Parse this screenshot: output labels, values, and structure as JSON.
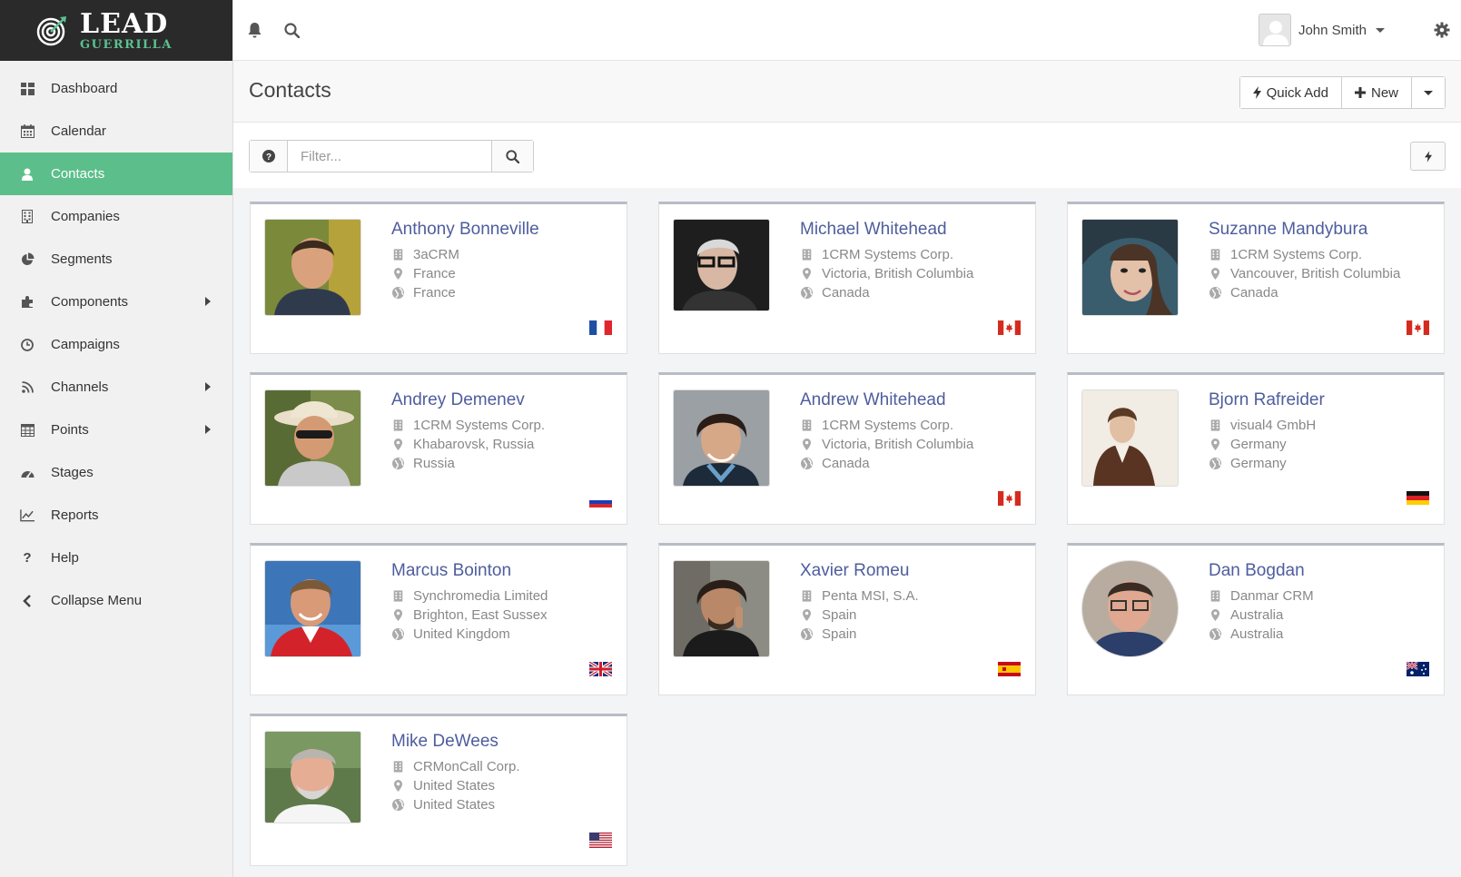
{
  "brand": {
    "main": "LEAD",
    "sub": "GUERRILLA"
  },
  "sidebar": {
    "items": [
      {
        "label": "Dashboard",
        "icon": "grid-icon"
      },
      {
        "label": "Calendar",
        "icon": "calendar-icon"
      },
      {
        "label": "Contacts",
        "icon": "user-icon",
        "active": true
      },
      {
        "label": "Companies",
        "icon": "building-icon"
      },
      {
        "label": "Segments",
        "icon": "pie-icon"
      },
      {
        "label": "Components",
        "icon": "puzzle-icon",
        "submenu": true
      },
      {
        "label": "Campaigns",
        "icon": "clock-icon"
      },
      {
        "label": "Channels",
        "icon": "rss-icon",
        "submenu": true
      },
      {
        "label": "Points",
        "icon": "table-icon",
        "submenu": true
      },
      {
        "label": "Stages",
        "icon": "tachometer-icon"
      },
      {
        "label": "Reports",
        "icon": "line-chart-icon"
      },
      {
        "label": "Help",
        "icon": "question-icon"
      },
      {
        "label": "Collapse Menu",
        "icon": "chevron-left-icon"
      }
    ]
  },
  "topbar": {
    "user_name": "John Smith"
  },
  "page": {
    "title": "Contacts",
    "quick_add_label": "Quick Add",
    "new_label": "New"
  },
  "filter": {
    "placeholder": "Filter..."
  },
  "contacts": [
    {
      "name": "Anthony Bonneville",
      "company": "3aCRM",
      "location": "France",
      "country": "France",
      "flag": "fr"
    },
    {
      "name": "Michael Whitehead",
      "company": "1CRM Systems Corp.",
      "location": "Victoria, British Columbia",
      "country": "Canada",
      "flag": "ca"
    },
    {
      "name": "Suzanne Mandybura",
      "company": "1CRM Systems Corp.",
      "location": "Vancouver, British Columbia",
      "country": "Canada",
      "flag": "ca"
    },
    {
      "name": "Andrey Demenev",
      "company": "1CRM Systems Corp.",
      "location": "Khabarovsk, Russia",
      "country": "Russia",
      "flag": "ru"
    },
    {
      "name": "Andrew Whitehead",
      "company": "1CRM Systems Corp.",
      "location": "Victoria, British Columbia",
      "country": "Canada",
      "flag": "ca"
    },
    {
      "name": "Bjorn Rafreider",
      "company": "visual4 GmbH",
      "location": "Germany",
      "country": "Germany",
      "flag": "de"
    },
    {
      "name": "Marcus Bointon",
      "company": "Synchromedia Limited",
      "location": "Brighton, East Sussex",
      "country": "United Kingdom",
      "flag": "gb"
    },
    {
      "name": "Xavier Romeu",
      "company": "Penta MSI, S.A.",
      "location": "Spain",
      "country": "Spain",
      "flag": "es"
    },
    {
      "name": "Dan Bogdan",
      "company": "Danmar CRM",
      "location": "Australia",
      "country": "Australia",
      "flag": "au"
    },
    {
      "name": "Mike DeWees",
      "company": "CRMonCall Corp.",
      "location": "United States",
      "country": "United States",
      "flag": "us"
    }
  ],
  "colors": {
    "accent": "#5cbf8b",
    "link": "#4e5d9d",
    "logo_bg": "#2a2a2a"
  }
}
